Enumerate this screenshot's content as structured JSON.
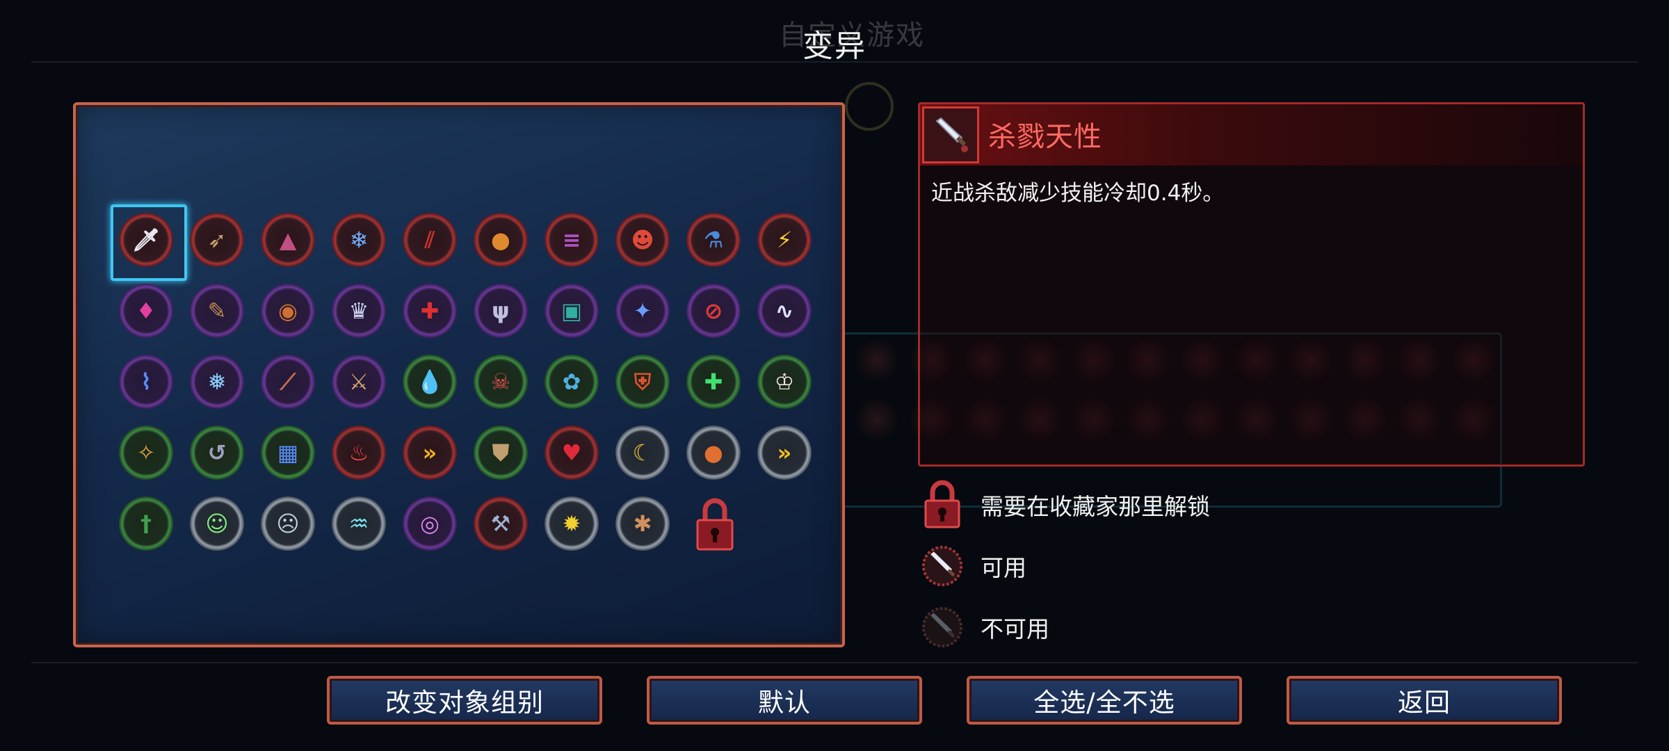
{
  "background": {
    "title": "自定义游戏"
  },
  "header": {
    "title": "变异"
  },
  "grid": {
    "mutations": [
      {
        "icon": "sword-icon",
        "ring": "red",
        "glyph": "🗡",
        "color": "#e8e8f0",
        "selected": true
      },
      {
        "icon": "crossbow-icon",
        "ring": "red",
        "glyph": "➶",
        "color": "#c8a070"
      },
      {
        "icon": "spike-trap-icon",
        "ring": "red",
        "glyph": "▲",
        "color": "#c05080"
      },
      {
        "icon": "ice-scythe-icon",
        "ring": "red",
        "glyph": "❄",
        "color": "#70b0ff"
      },
      {
        "icon": "slash-claw-icon",
        "ring": "red",
        "glyph": "⫽",
        "color": "#c03030"
      },
      {
        "icon": "bomb-icon",
        "ring": "red",
        "glyph": "●",
        "color": "#e08a30"
      },
      {
        "icon": "cannon-icon",
        "ring": "red",
        "glyph": "≡",
        "color": "#b050c0"
      },
      {
        "icon": "red-skull-icon",
        "ring": "red",
        "glyph": "☻",
        "color": "#e04a3a"
      },
      {
        "icon": "blue-potion-icon",
        "ring": "red",
        "glyph": "⚗",
        "color": "#4a8ae0"
      },
      {
        "icon": "lightning-icon",
        "ring": "red",
        "glyph": "⚡",
        "color": "#f0d040"
      },
      {
        "icon": "pink-crystal-icon",
        "ring": "purple",
        "glyph": "♦",
        "color": "#e040a0"
      },
      {
        "icon": "dagger-scroll-icon",
        "ring": "purple",
        "glyph": "✎",
        "color": "#c08a50"
      },
      {
        "icon": "ring-icon",
        "ring": "purple",
        "glyph": "◉",
        "color": "#d07030"
      },
      {
        "icon": "jester-icon",
        "ring": "purple",
        "glyph": "♛",
        "color": "#d0d0f0"
      },
      {
        "icon": "target-icon",
        "ring": "purple",
        "glyph": "✚",
        "color": "#e03030"
      },
      {
        "icon": "trident-icon",
        "ring": "purple",
        "glyph": "ψ",
        "color": "#c0c0e0"
      },
      {
        "icon": "teal-scroll-icon",
        "ring": "purple",
        "glyph": "▣",
        "color": "#30b0a0"
      },
      {
        "icon": "blue-blade-icon",
        "ring": "purple",
        "glyph": "✦",
        "color": "#6a9aff"
      },
      {
        "icon": "no-entry-icon",
        "ring": "purple",
        "glyph": "⊘",
        "color": "#e03a3a"
      },
      {
        "icon": "wind-icon",
        "ring": "purple",
        "glyph": "∿",
        "color": "#e0e0ff"
      },
      {
        "icon": "blue-wave-icon",
        "ring": "purple",
        "glyph": "⌇",
        "color": "#5a8aff"
      },
      {
        "icon": "frost-arrow-icon",
        "ring": "purple",
        "glyph": "❅",
        "color": "#8ad0ff"
      },
      {
        "icon": "staff-icon",
        "ring": "purple",
        "glyph": "⟋",
        "color": "#c07050"
      },
      {
        "icon": "scroll-sword-icon",
        "ring": "purple",
        "glyph": "⚔",
        "color": "#d0a070"
      },
      {
        "icon": "purple-drop-icon",
        "ring": "green",
        "glyph": "💧",
        "color": "#b050e0"
      },
      {
        "icon": "crossbones-icon",
        "ring": "green",
        "glyph": "☠",
        "color": "#e05050"
      },
      {
        "icon": "blue-flower-icon",
        "ring": "green",
        "glyph": "✿",
        "color": "#50b0e0"
      },
      {
        "icon": "shield-icon",
        "ring": "green",
        "glyph": "⛨",
        "color": "#e05030"
      },
      {
        "icon": "green-cross-icon",
        "ring": "green",
        "glyph": "✚",
        "color": "#40e070"
      },
      {
        "icon": "fangs-icon",
        "ring": "green",
        "glyph": "♔",
        "color": "#f0e0e0"
      },
      {
        "icon": "torch-icon",
        "ring": "green",
        "glyph": "✧",
        "color": "#e0a040"
      },
      {
        "icon": "hook-icon",
        "ring": "green",
        "glyph": "↺",
        "color": "#a0a0c0"
      },
      {
        "icon": "barrier-icon",
        "ring": "green",
        "glyph": "▦",
        "color": "#5a8aff"
      },
      {
        "icon": "red-flame-icon",
        "ring": "red",
        "glyph": "♨",
        "color": "#ff4a4a"
      },
      {
        "icon": "chevron-right-icon",
        "ring": "red",
        "glyph": "»",
        "color": "#f0b020"
      },
      {
        "icon": "scroll-shield-icon",
        "ring": "green",
        "glyph": "⛊",
        "color": "#c0a070"
      },
      {
        "icon": "heart-icon",
        "ring": "red",
        "glyph": "♥",
        "color": "#e02a3a"
      },
      {
        "icon": "banana-icon",
        "ring": "white",
        "glyph": "☾",
        "color": "#f0c040"
      },
      {
        "icon": "orange-potion-icon",
        "ring": "white",
        "glyph": "●",
        "color": "#e07030"
      },
      {
        "icon": "double-chevron-icon",
        "ring": "white",
        "glyph": "»",
        "color": "#f0c020"
      },
      {
        "icon": "green-dagger-icon",
        "ring": "green",
        "glyph": "†",
        "color": "#40a050"
      },
      {
        "icon": "green-skull-icon",
        "ring": "white",
        "glyph": "☺",
        "color": "#80f080"
      },
      {
        "icon": "skull-icon",
        "ring": "white",
        "glyph": "☹",
        "color": "#c0d0e0"
      },
      {
        "icon": "fountain-icon",
        "ring": "white",
        "glyph": "♒",
        "color": "#80e0f0"
      },
      {
        "icon": "purple-orb-icon",
        "ring": "purple",
        "glyph": "◎",
        "color": "#e080f0"
      },
      {
        "icon": "hammer-icon",
        "ring": "red",
        "glyph": "⚒",
        "color": "#a0b0d0"
      },
      {
        "icon": "sun-icon",
        "ring": "white",
        "glyph": "✹",
        "color": "#f0d030"
      },
      {
        "icon": "grenade-icon",
        "ring": "white",
        "glyph": "✱",
        "color": "#d09060"
      },
      {
        "icon": "lock-icon",
        "ring": "lock"
      }
    ]
  },
  "detail": {
    "icon": "sword-icon",
    "name": "杀戮天性",
    "description": "近战杀敌减少技能冷却0.4秒。"
  },
  "legend": {
    "locked": "需要在收藏家那里解锁",
    "available": "可用",
    "unavailable": "不可用"
  },
  "buttons": {
    "change_group": "改变对象组别",
    "default": "默认",
    "select_all": "全选/全不选",
    "back": "返回"
  },
  "colors": {
    "accent_border": "#c8644c",
    "selection": "#3fc7f4",
    "detail_title": "#ff6a62"
  }
}
